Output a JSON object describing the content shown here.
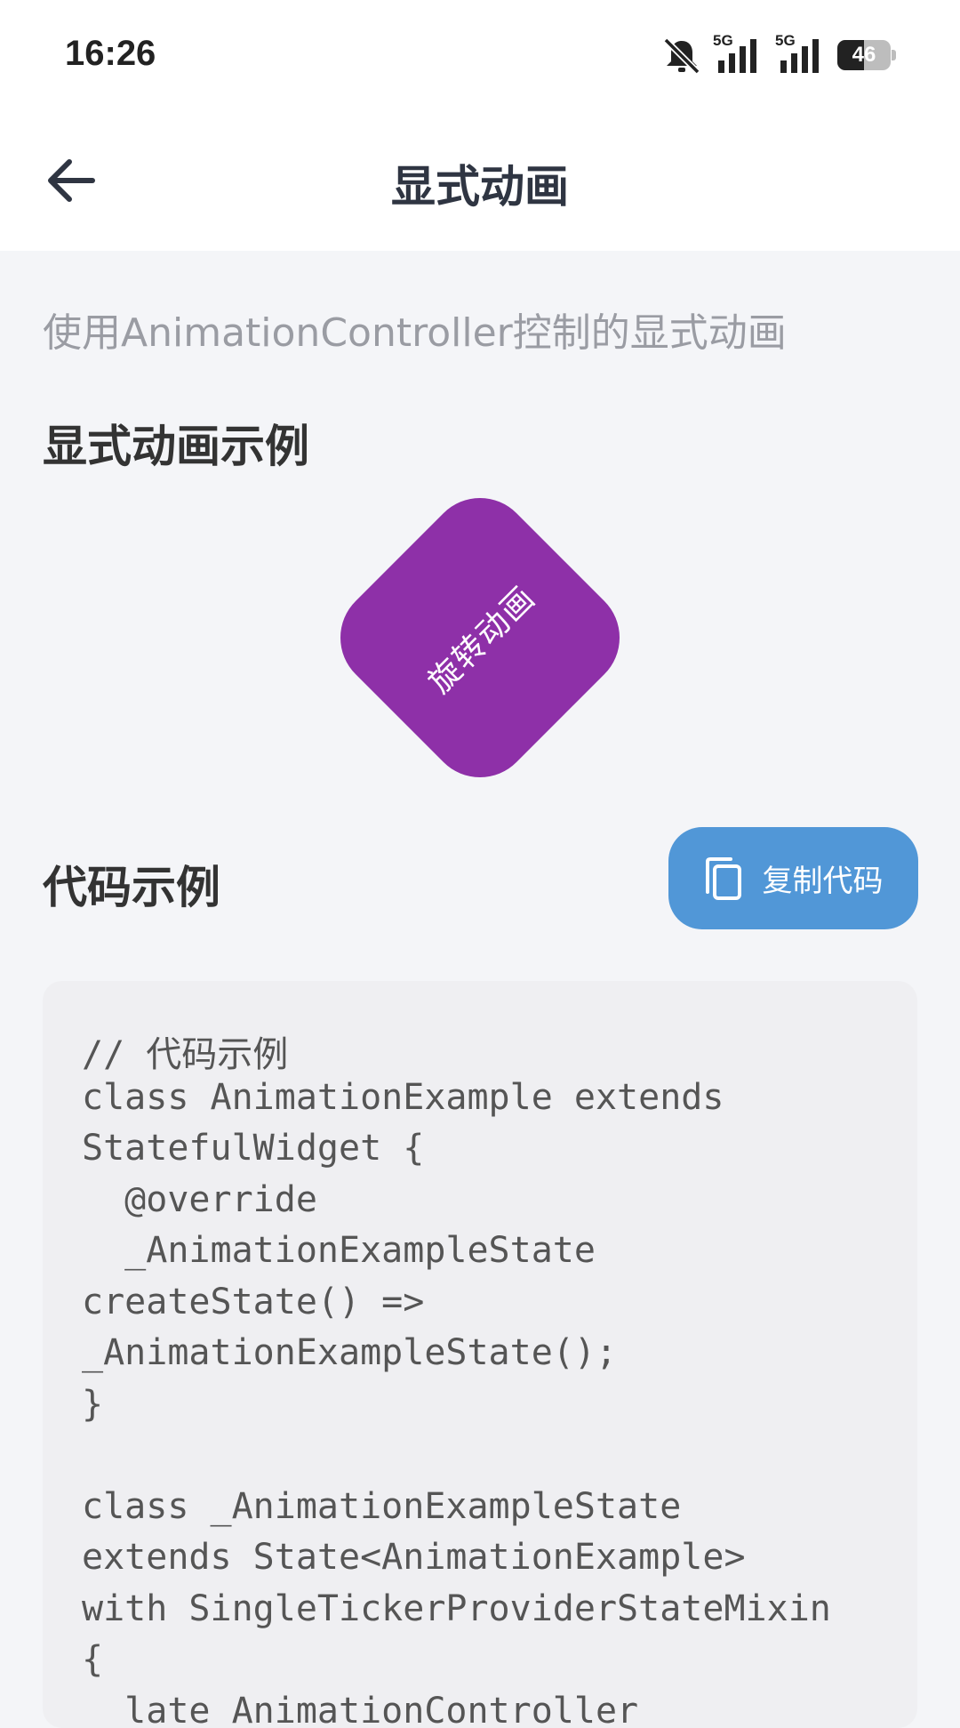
{
  "status": {
    "time": "16:26",
    "battery": "46",
    "signal1": "5G",
    "signal2": "5G"
  },
  "header": {
    "title": "显式动画"
  },
  "subtitle": "使用AnimationController控制的显式动画",
  "demo": {
    "section_title": "显式动画示例",
    "label": "旋转动画",
    "color": "#8e30a8"
  },
  "code": {
    "section_title": "代码示例",
    "copy_label": "复制代码",
    "lines": [
      "// 代码示例",
      "class AnimationExample extends",
      "StatefulWidget {",
      "  @override",
      "  _AnimationExampleState",
      "createState() =>",
      "_AnimationExampleState();",
      "}",
      "",
      "class _AnimationExampleState",
      "extends State<AnimationExample>",
      "with SingleTickerProviderStateMixin",
      "{",
      "  late AnimationController"
    ]
  },
  "colors": {
    "accent": "#5197d7",
    "background": "#f4f5f8"
  },
  "icons": {
    "back": "back-arrow-icon",
    "copy": "copy-icon",
    "mute": "bell-mute-icon",
    "signal": "signal-icon",
    "battery": "battery-icon"
  }
}
